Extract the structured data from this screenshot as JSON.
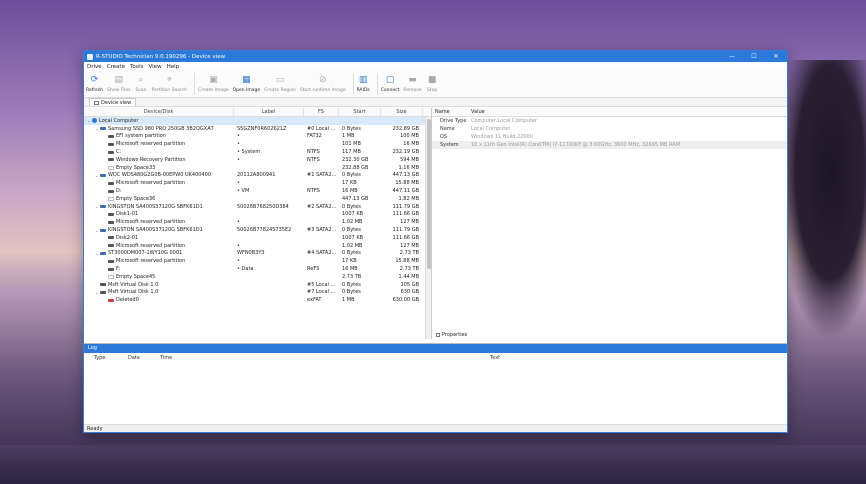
{
  "window": {
    "title": "R-STUDIO Technician 9.0.190296 - Device view",
    "min_icon": "—",
    "max_icon": "☐",
    "close_icon": "✕"
  },
  "menu": [
    "Drive",
    "Create",
    "Tools",
    "View",
    "Help"
  ],
  "toolbar": [
    {
      "label": "Refresh",
      "icon": "refresh-icon",
      "active": true
    },
    {
      "label": "Show Files",
      "icon": "show-files-icon",
      "active": false
    },
    {
      "label": "Scan",
      "icon": "scan-icon",
      "active": false
    },
    {
      "label": "Partition Search",
      "icon": "partition-search-icon",
      "active": false
    },
    {
      "label": "Create Image",
      "icon": "create-image-icon",
      "active": false
    },
    {
      "label": "Open Image",
      "icon": "open-image-icon",
      "active": true
    },
    {
      "label": "Create Region",
      "icon": "create-region-icon",
      "active": false
    },
    {
      "label": "Start runtime Image",
      "icon": "runtime-image-icon",
      "active": false
    },
    {
      "label": "RAIDs",
      "icon": "raids-icon",
      "active": true
    },
    {
      "label": "Connect",
      "icon": "connect-icon",
      "active": true
    },
    {
      "label": "Remove",
      "icon": "remove-icon",
      "active": false
    },
    {
      "label": "Stop",
      "icon": "stop-icon",
      "active": false
    }
  ],
  "subtab": {
    "label": "Device view"
  },
  "device_table": {
    "columns": [
      "Device/Disk",
      "Label",
      "FS",
      "Start",
      "Size"
    ],
    "rows": [
      {
        "level": 0,
        "icon": "computer",
        "name": "Local Computer",
        "label": "",
        "fs": "",
        "start": "",
        "size": "",
        "selected": true,
        "expand": true
      },
      {
        "level": 1,
        "icon": "disk",
        "name": "Samsung SSD 980 PRO 250GB 3B2QGXA7",
        "label": "S5GZNF0R602621Z",
        "fs": "#0 Local ...",
        "start": "0 Bytes",
        "size": "232.89 GB",
        "expand": true
      },
      {
        "level": 2,
        "icon": "part",
        "name": "EFI system partition",
        "label": "•",
        "fs": "FAT32",
        "start": "1 MB",
        "size": "100 MB"
      },
      {
        "level": 2,
        "icon": "part",
        "name": "Microsoft reserved partition",
        "label": "•",
        "fs": "",
        "start": "101 MB",
        "size": "16 MB"
      },
      {
        "level": 2,
        "icon": "part",
        "name": "C:",
        "label": "• System",
        "fs": "NTFS",
        "start": "117 MB",
        "size": "232.19 GB"
      },
      {
        "level": 2,
        "icon": "part",
        "name": "Windows Recovery Partition",
        "label": "•",
        "fs": "NTFS",
        "start": "232.30 GB",
        "size": "594 MB"
      },
      {
        "level": 2,
        "icon": "empty",
        "name": "Empty Space33",
        "label": "",
        "fs": "",
        "start": "232.88 GB",
        "size": "1.16 MB"
      },
      {
        "level": 1,
        "icon": "disk",
        "name": "WDC WDS480G2G0B-00EPW0 UK400400",
        "label": "20112A800941",
        "fs": "#1 SATA2...",
        "start": "0 Bytes",
        "size": "447.13 GB",
        "expand": true
      },
      {
        "level": 2,
        "icon": "part",
        "name": "Microsoft reserved partition",
        "label": "•",
        "fs": "",
        "start": "17 KB",
        "size": "15.88 MB"
      },
      {
        "level": 2,
        "icon": "part",
        "name": "D:",
        "label": "• VM",
        "fs": "NTFS",
        "start": "16 MB",
        "size": "447.11 GB"
      },
      {
        "level": 2,
        "icon": "empty",
        "name": "Empty Space36",
        "label": "",
        "fs": "",
        "start": "447.13 GB",
        "size": "1.82 MB"
      },
      {
        "level": 1,
        "icon": "disk",
        "name": "KINGSTON SA400S37120G SBFK61D1",
        "label": "50026B768250D384",
        "fs": "#2 SATA2...",
        "start": "0 Bytes",
        "size": "111.79 GB",
        "expand": true
      },
      {
        "level": 2,
        "icon": "part",
        "name": "Disk1-01",
        "label": "",
        "fs": "",
        "start": "1007 KB",
        "size": "111.66 GB"
      },
      {
        "level": 2,
        "icon": "part",
        "name": "Microsoft reserved partition",
        "label": "•",
        "fs": "",
        "start": "1.02 MB",
        "size": "127 MB"
      },
      {
        "level": 1,
        "icon": "disk",
        "name": "KINGSTON SA400S37120G SBFK61D1",
        "label": "50026B778245735E2",
        "fs": "#3 SATA2...",
        "start": "0 Bytes",
        "size": "111.79 GB",
        "expand": true
      },
      {
        "level": 2,
        "icon": "part",
        "name": "Disk2-01",
        "label": "",
        "fs": "",
        "start": "1007 KB",
        "size": "111.66 GB"
      },
      {
        "level": 2,
        "icon": "part",
        "name": "Microsoft reserved partition",
        "label": "•",
        "fs": "",
        "start": "1.02 MB",
        "size": "127 MB"
      },
      {
        "level": 1,
        "icon": "disk",
        "name": "ST3000DM007-1WY10G 0001",
        "label": "WFN0B3Y3",
        "fs": "#4 SATA2...",
        "start": "0 Bytes",
        "size": "2.73 TB",
        "expand": true
      },
      {
        "level": 2,
        "icon": "part",
        "name": "Microsoft reserved partition",
        "label": "•",
        "fs": "",
        "start": "17 KB",
        "size": "15.88 MB"
      },
      {
        "level": 2,
        "icon": "part",
        "name": "F:",
        "label": "• Data",
        "fs": "ReFS",
        "start": "16 MB",
        "size": "2.73 TB"
      },
      {
        "level": 2,
        "icon": "empty",
        "name": "Empty Space45",
        "label": "",
        "fs": "",
        "start": "2.73 TB",
        "size": "1.44 MB"
      },
      {
        "level": 1,
        "icon": "part",
        "name": "Msft Virtual Disk 1.0",
        "label": "",
        "fs": "#5 Local ...",
        "start": "0 Bytes",
        "size": "105 GB"
      },
      {
        "level": 1,
        "icon": "part",
        "name": "Msft Virtual Disk 1.0",
        "label": "",
        "fs": "#7 Local ...",
        "start": "0 Bytes",
        "size": "630 GB",
        "expand": true
      },
      {
        "level": 2,
        "icon": "del",
        "name": "Deleted0",
        "label": "",
        "fs": "exFAT",
        "start": "1 MB",
        "size": "630.00 GB"
      }
    ]
  },
  "properties": {
    "columns": [
      "Name",
      "Value"
    ],
    "rows": [
      {
        "name": "Drive Type",
        "value": "Computer,Local Computer"
      },
      {
        "name": "Name",
        "value": "Local Computer"
      },
      {
        "name": "OS",
        "value": "Windows 11 Build 22000"
      },
      {
        "name": "System",
        "value": "16 x 11th Gen Intel(R) Core(TM) i7-11700KF @ 3.60GHz, 3600 MHz, 32695 MB RAM"
      }
    ],
    "tab_label": "Properties"
  },
  "log": {
    "title": "Log",
    "columns": [
      "Type",
      "Date",
      "Time",
      "Text"
    ]
  },
  "status": "Ready",
  "colors": {
    "accent": "#2b79d8",
    "selection": "#d9e8fb"
  }
}
